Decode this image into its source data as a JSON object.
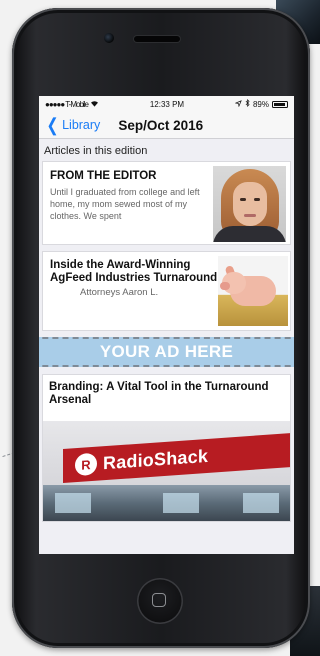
{
  "status_bar": {
    "signal": "●●●●● T-Mobile",
    "wifi_icon": "wifi-icon",
    "time": "12:33 PM",
    "battery_text": "89%",
    "battery_level": 0.89
  },
  "nav": {
    "back_label": "Library",
    "title": "Sep/Oct 2016"
  },
  "section_header": "Articles in this edition",
  "articles": [
    {
      "title": "FROM THE EDITOR",
      "excerpt": "Until I graduated from college and left home, my mom sewed most of my clothes. We spent"
    },
    {
      "title": "Inside the Award-Winning AgFeed Industries Turnaround",
      "excerpt": "Attorneys Aaron L."
    },
    {
      "title": "Branding: A Vital Tool in the Turnaround Arsenal",
      "image_text": "RadioShack"
    }
  ],
  "ad_banner": "YOUR AD HERE",
  "colors": {
    "accent": "#1a7cf5",
    "ad_background": "#a9cde8",
    "brand_red": "#b71c22"
  }
}
